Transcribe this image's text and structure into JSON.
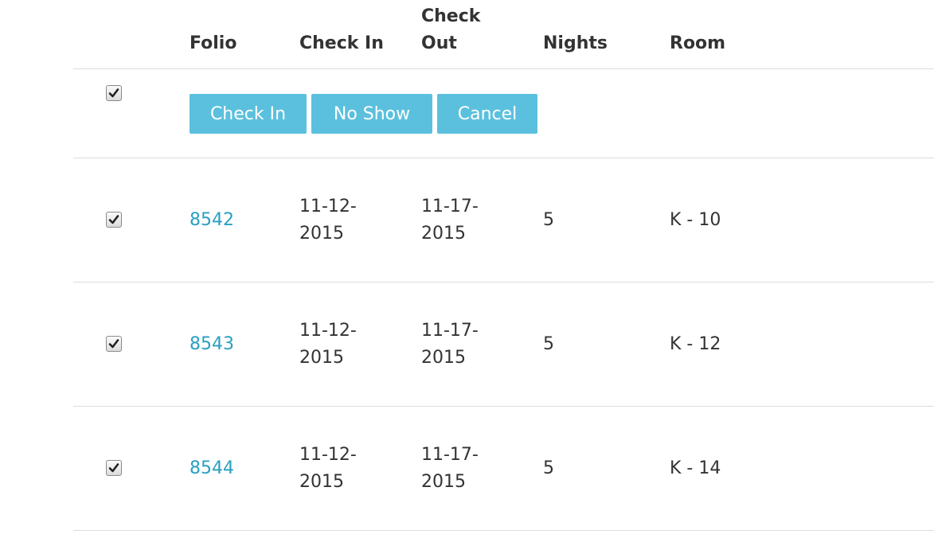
{
  "table": {
    "headers": {
      "folio": "Folio",
      "check_in": "Check In",
      "check_out": "Check Out",
      "nights": "Nights",
      "room": "Room"
    },
    "actions": {
      "check_in_label": "Check In",
      "no_show_label": "No Show",
      "cancel_label": "Cancel"
    },
    "rows": [
      {
        "folio": "8542",
        "check_in": "11-12-2015",
        "check_out": "11-17-2015",
        "nights": "5",
        "room": "K - 10",
        "checked": true
      },
      {
        "folio": "8543",
        "check_in": "11-12-2015",
        "check_out": "11-17-2015",
        "nights": "5",
        "room": "K - 12",
        "checked": true
      },
      {
        "folio": "8544",
        "check_in": "11-12-2015",
        "check_out": "11-17-2015",
        "nights": "5",
        "room": "K - 14",
        "checked": true
      }
    ],
    "select_all_checked": true
  },
  "colors": {
    "button_bg": "#5bc0de",
    "link": "#2a9fc2",
    "text": "#333333",
    "divider": "#dddddd"
  }
}
